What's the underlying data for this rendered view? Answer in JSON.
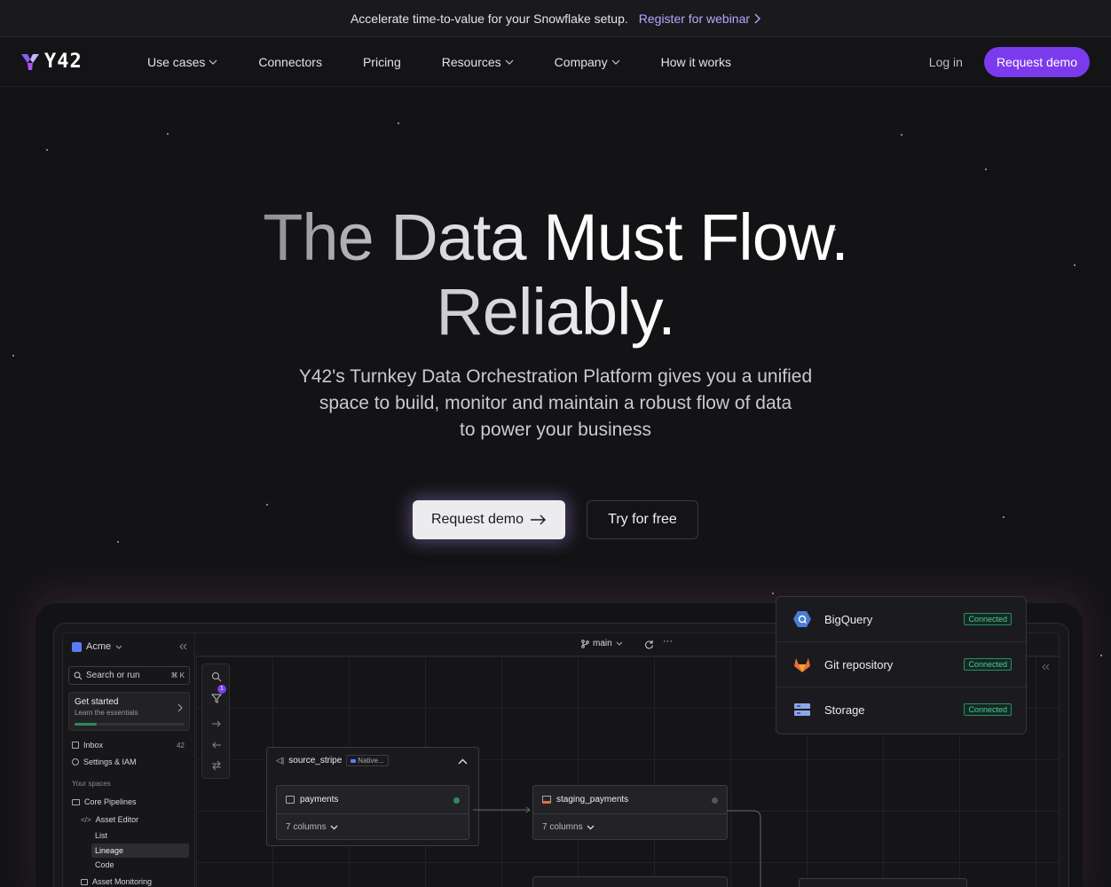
{
  "announcement": {
    "text": "Accelerate time-to-value for your Snowflake setup.",
    "link": "Register for webinar"
  },
  "nav": {
    "logo_text": "Y42",
    "items": [
      {
        "label": "Use cases",
        "dropdown": true
      },
      {
        "label": "Connectors",
        "dropdown": false
      },
      {
        "label": "Pricing",
        "dropdown": false
      },
      {
        "label": "Resources",
        "dropdown": true
      },
      {
        "label": "Company",
        "dropdown": true
      },
      {
        "label": "How it works",
        "dropdown": false
      }
    ],
    "login": "Log in",
    "request_demo": "Request demo"
  },
  "hero": {
    "headline_line1": "The Data Must Flow.",
    "headline_line2": "Reliably.",
    "sub_line1": "Y42's Turnkey Data Orchestration Platform gives you a unified",
    "sub_line2": "space to build, monitor and maintain a robust flow of data",
    "sub_line3": "to power your business",
    "cta_primary": "Request demo",
    "cta_secondary": "Try for free"
  },
  "app": {
    "workspace": "Acme",
    "search_placeholder": "Search or run",
    "search_shortcut": "⌘ K",
    "get_started_title": "Get started",
    "get_started_sub": "Learn the essentials",
    "inbox_label": "Inbox",
    "inbox_count": "42",
    "settings_label": "Settings & IAM",
    "spaces_header": "Your spaces",
    "core_pipelines": "Core Pipelines",
    "asset_editor": "Asset Editor",
    "list": "List",
    "lineage": "Lineage",
    "code": "Code",
    "asset_monitoring": "Asset Monitoring",
    "branch": "main",
    "filter_badge": "1",
    "source_node": "source_stripe",
    "source_tag": "Native...",
    "payments_table": "payments",
    "columns_1": "7 columns",
    "staging_table": "staging_payments",
    "columns_2": "7 columns"
  },
  "connections": [
    {
      "name": "BigQuery",
      "status": "Connected",
      "icon": "bigquery-icon"
    },
    {
      "name": "Git repository",
      "status": "Connected",
      "icon": "gitlab-icon"
    },
    {
      "name": "Storage",
      "status": "Connected",
      "icon": "storage-icon"
    }
  ],
  "colors": {
    "accent": "#7c3aed",
    "link": "#b7a6ff",
    "connected": "#59c49b",
    "background": "#131316"
  }
}
